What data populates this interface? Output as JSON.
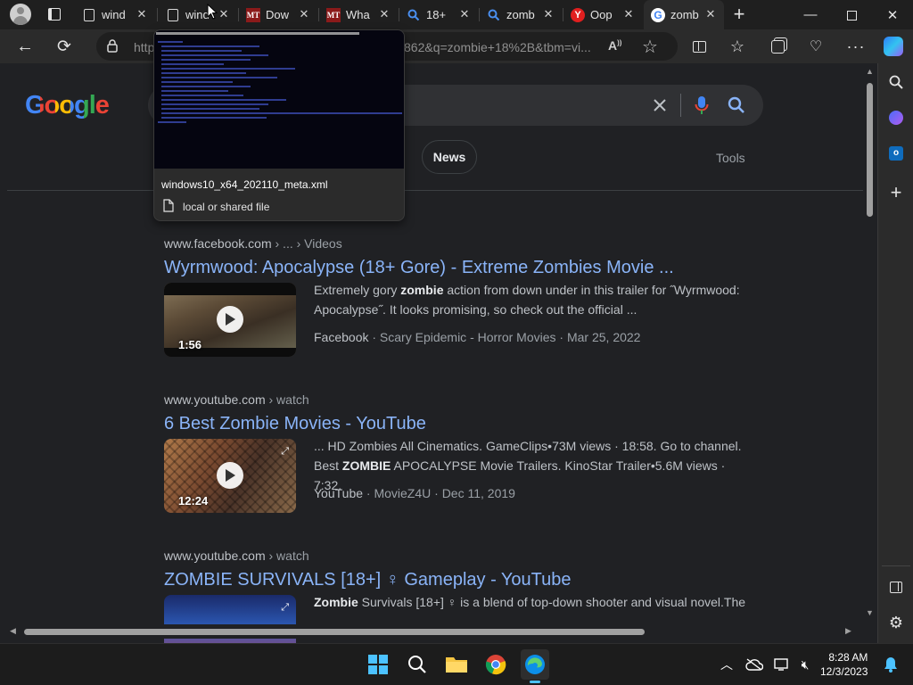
{
  "tabs": [
    {
      "title": "wind",
      "icon": "document-icon"
    },
    {
      "title": "wind",
      "icon": "document-icon"
    },
    {
      "title": "Dow",
      "icon": "mt-logo-icon"
    },
    {
      "title": "Wha",
      "icon": "mt-logo-icon"
    },
    {
      "title": "18+",
      "icon": "search-icon"
    },
    {
      "title": "zomb",
      "icon": "search-icon"
    },
    {
      "title": "Oop",
      "icon": "yandex-icon"
    },
    {
      "title": "zomb",
      "icon": "google-icon"
    }
  ],
  "favicon_text": {
    "mt": "MT",
    "y": "Y",
    "g": "G"
  },
  "address_bar": {
    "left": "http",
    "right": "862&q=zombie+18%2B&tbm=vi..."
  },
  "hover_card": {
    "title": "windows10_x64_202110_meta.xml",
    "subtitle": "local or shared file"
  },
  "google": {
    "logo": "Google",
    "chips": [
      "News"
    ],
    "tools_label": "Tools"
  },
  "results": [
    {
      "site": "www.facebook.com",
      "path": " › ... › Videos",
      "title": "Wyrmwood: Apocalypse (18+ Gore) - Extreme Zombies Movie ...",
      "snippet_a": "Extremely gory ",
      "snippet_bold": "zombie",
      "snippet_b": " action from down under in this trailer for ˝Wyrmwood: Apocalypse˝. It looks promising, so check out the official ...",
      "duration": "1:56",
      "source": "Facebook",
      "meta_rest": " · Scary Epidemic - Horror Movies · Mar 25, 2022"
    },
    {
      "site": "www.youtube.com",
      "path": " › watch",
      "title": "6 Best Zombie Movies - YouTube",
      "snippet_a": "... HD Zombies All Cinematics. GameClips•73M views · 18:58. Go to channel. Best ",
      "snippet_bold": "ZOMBIE",
      "snippet_b": " APOCALYPSE Movie Trailers. KinoStar Trailer•5.6M views · 7:32.",
      "duration": "12:24",
      "source": "YouTube",
      "meta_rest": " · MovieZ4U · Dec 11, 2019"
    },
    {
      "site": "www.youtube.com",
      "path": " › watch",
      "title": "ZOMBIE SURVIVALS [18+] ♀ Gameplay - YouTube",
      "snippet_a": "",
      "snippet_bold": "Zombie",
      "snippet_b": " Survivals [18+] ♀ is a blend of top-down shooter and visual novel.The"
    }
  ],
  "clock": {
    "time": "8:28 AM",
    "date": "12/3/2023"
  },
  "colors": {
    "link": "#8ab4f8",
    "page_bg": "#202124",
    "tab_bg": "#1f1f1f",
    "active_tab": "#2b2b2b"
  }
}
